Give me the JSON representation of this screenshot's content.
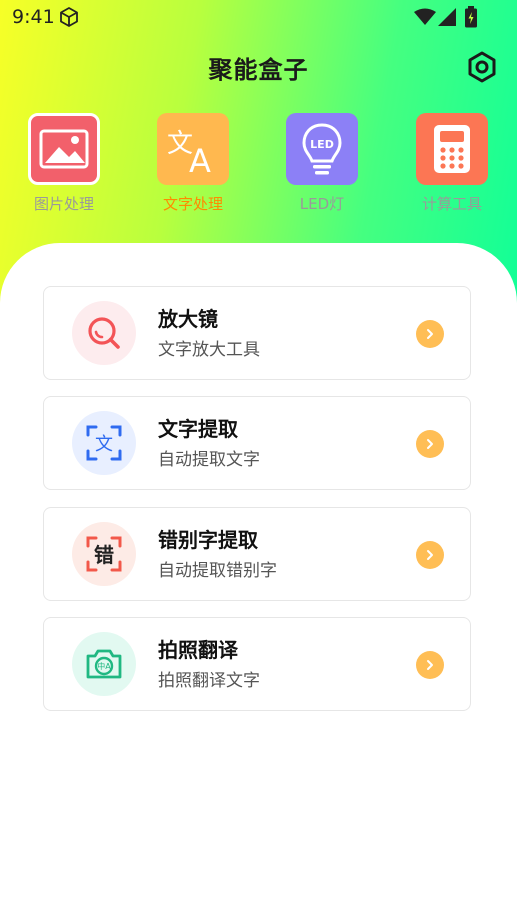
{
  "status_bar": {
    "time": "9:41"
  },
  "header": {
    "title": "聚能盒子"
  },
  "categories": [
    {
      "label": "图片处理",
      "icon": "image-icon",
      "active": false
    },
    {
      "label": "文字处理",
      "icon": "translate-icon",
      "active": true
    },
    {
      "label": "LED灯",
      "icon": "led-bulb-icon",
      "active": false,
      "icon_text": "LED"
    },
    {
      "label": "计算工具",
      "icon": "calculator-icon",
      "active": false
    }
  ],
  "features": [
    {
      "title": "放大镜",
      "subtitle": "文字放大工具",
      "icon": "magnifier-icon"
    },
    {
      "title": "文字提取",
      "subtitle": "自动提取文字",
      "icon": "text-scan-icon",
      "icon_text": "文"
    },
    {
      "title": "错别字提取",
      "subtitle": "自动提取错别字",
      "icon": "typo-scan-icon",
      "icon_text": "错"
    },
    {
      "title": "拍照翻译",
      "subtitle": "拍照翻译文字",
      "icon": "camera-translate-icon",
      "icon_text": "中A"
    }
  ],
  "colors": {
    "gradient_start": "#f7ff27",
    "gradient_end": "#10ff98",
    "active_tab": "#ff8a00",
    "arrow": "#ffbe55"
  }
}
